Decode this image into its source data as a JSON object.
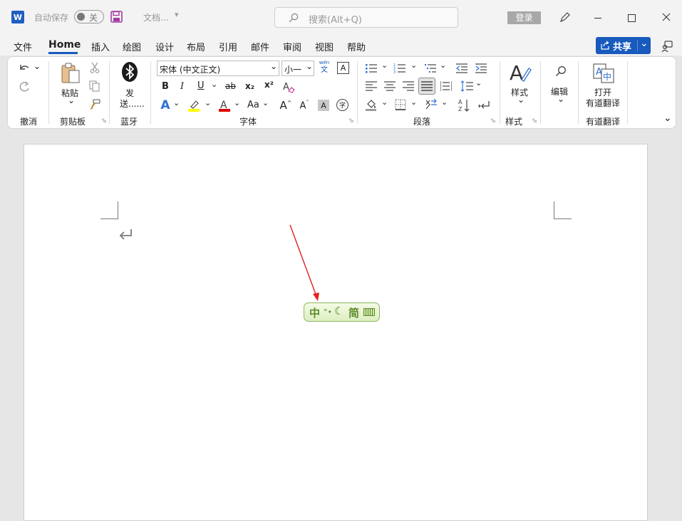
{
  "titlebar": {
    "autosave_label": "自动保存",
    "autosave_state": "关",
    "doc_title": "文档...",
    "search_placeholder": "搜索(Alt+Q)",
    "login_label": "登录"
  },
  "tabs": [
    {
      "label": "文件"
    },
    {
      "label": "Home"
    },
    {
      "label": "插入"
    },
    {
      "label": "绘图"
    },
    {
      "label": "设计"
    },
    {
      "label": "布局"
    },
    {
      "label": "引用"
    },
    {
      "label": "邮件"
    },
    {
      "label": "审阅"
    },
    {
      "label": "视图"
    },
    {
      "label": "帮助"
    }
  ],
  "share_label": "共享",
  "ribbon": {
    "groups": {
      "undo": "撤消",
      "clipboard": "剪贴板",
      "bluetooth": "蓝牙",
      "font": "字体",
      "paragraph": "段落",
      "styles": "样式",
      "youdao": "有道翻译"
    },
    "paste_label": "粘贴",
    "send_label_1": "发",
    "send_label_2": "送......",
    "font_name": "宋体 (中文正文)",
    "font_size": "小一",
    "styles_label": "样式",
    "edit_label": "编辑",
    "open_label": "打开",
    "youdao_label": "有道翻译",
    "font_buttons": {
      "bold": "B",
      "italic": "I",
      "underline": "U",
      "strike": "ab",
      "subscript": "x₂",
      "superscript": "x²",
      "case": "Aa"
    },
    "phonetic_top": "wén",
    "phonetic_bottom": "文"
  },
  "ime": {
    "lang": "中",
    "mode": "简"
  },
  "colors": {
    "accent": "#185abd",
    "highlight": "#ffff00",
    "font_color": "#e00000",
    "arrow": "#e02020",
    "ime_green": "#5d8a2a"
  }
}
